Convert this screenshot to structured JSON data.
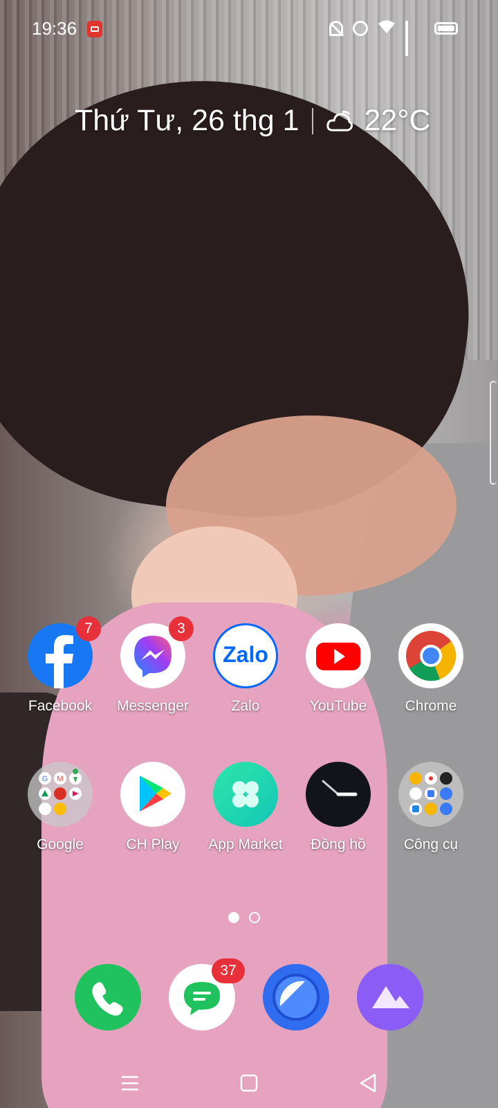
{
  "status_bar": {
    "time": "19:36",
    "icons": [
      "screen-record-icon",
      "bell-off-icon",
      "alarm-icon",
      "wifi-icon",
      "signal-icon",
      "battery-icon"
    ]
  },
  "widget": {
    "date": "Thứ Tư, 26 thg 1",
    "weather_icon": "partly-cloudy-night-icon",
    "temperature": "22°C"
  },
  "apps_row1": [
    {
      "name": "Facebook",
      "badge": "7",
      "icon": "facebook-icon"
    },
    {
      "name": "Messenger",
      "badge": "3",
      "icon": "messenger-icon"
    },
    {
      "name": "Zalo",
      "badge": "",
      "icon": "zalo-icon",
      "icon_text": "Zalo"
    },
    {
      "name": "YouTube",
      "badge": "",
      "icon": "youtube-icon"
    },
    {
      "name": "Chrome",
      "badge": "",
      "icon": "chrome-icon"
    }
  ],
  "apps_row2": [
    {
      "name": "Google",
      "icon": "google-folder-icon"
    },
    {
      "name": "CH Play",
      "icon": "play-store-icon"
    },
    {
      "name": "App Market",
      "icon": "app-market-icon"
    },
    {
      "name": "Đồng hồ",
      "icon": "clock-icon"
    },
    {
      "name": "Công cụ",
      "icon": "tools-folder-icon"
    }
  ],
  "page_indicator": {
    "pages": 2,
    "current": 1
  },
  "dock": [
    {
      "icon": "phone-icon",
      "badge": ""
    },
    {
      "icon": "messages-icon",
      "badge": "37"
    },
    {
      "icon": "browser-icon",
      "badge": ""
    },
    {
      "icon": "photos-icon",
      "badge": ""
    }
  ],
  "nav": [
    "menu-icon",
    "home-icon",
    "back-icon"
  ],
  "colors": {
    "badge": "#e8303a",
    "phone": "#1fc25c",
    "browser": "#2f6cf0",
    "photos": "#8b5cf6",
    "facebook": "#1877f2",
    "youtube": "#ff0000"
  }
}
